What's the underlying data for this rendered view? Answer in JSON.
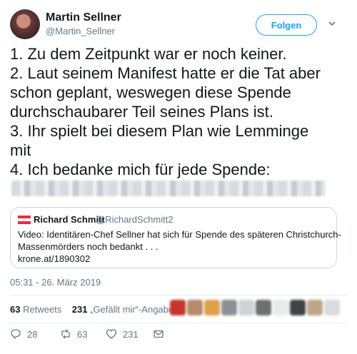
{
  "author": {
    "name": "Martin Sellner",
    "handle": "@Martin_Sellner",
    "follow_label": "Folgen"
  },
  "tweet": {
    "lines": [
      "1. Zu dem Zeitpunkt war er noch keiner.",
      "2. Laut seinem Manifest hatte er die Tat aber",
      "schon geplant, weswegen diese Spende",
      "durchschaubarer Teil seines Plans ist.",
      "3. Ihr spielt bei diesem Plan wie Lemminge",
      "mit",
      "4. Ich bedanke mich für jede Spende:"
    ]
  },
  "quoted": {
    "name": "Richard Schmitt",
    "handle": "@RichardSchmitt2",
    "text_lines": [
      "Video: Identitären-Chef Sellner hat sich für Spende des späteren Christchurch-",
      "Massenmörders noch bedankt . . .",
      "krone.at/1890302"
    ],
    "flag_colors": [
      "#ed2939",
      "#ffffff",
      "#ed2939"
    ]
  },
  "meta": {
    "timestamp": "05:31 - 26. März 2019"
  },
  "stats": {
    "retweets_count": "63",
    "retweets_label": "Retweets",
    "likes_count": "231",
    "likes_label": "„Gefällt mir“-Angaben"
  },
  "actions": {
    "reply_count": "28",
    "retweet_count": "63",
    "like_count": "231"
  },
  "colors": {
    "accent": "#1da1f2",
    "secondary_text": "#657786",
    "divider": "#e6ecf0"
  }
}
